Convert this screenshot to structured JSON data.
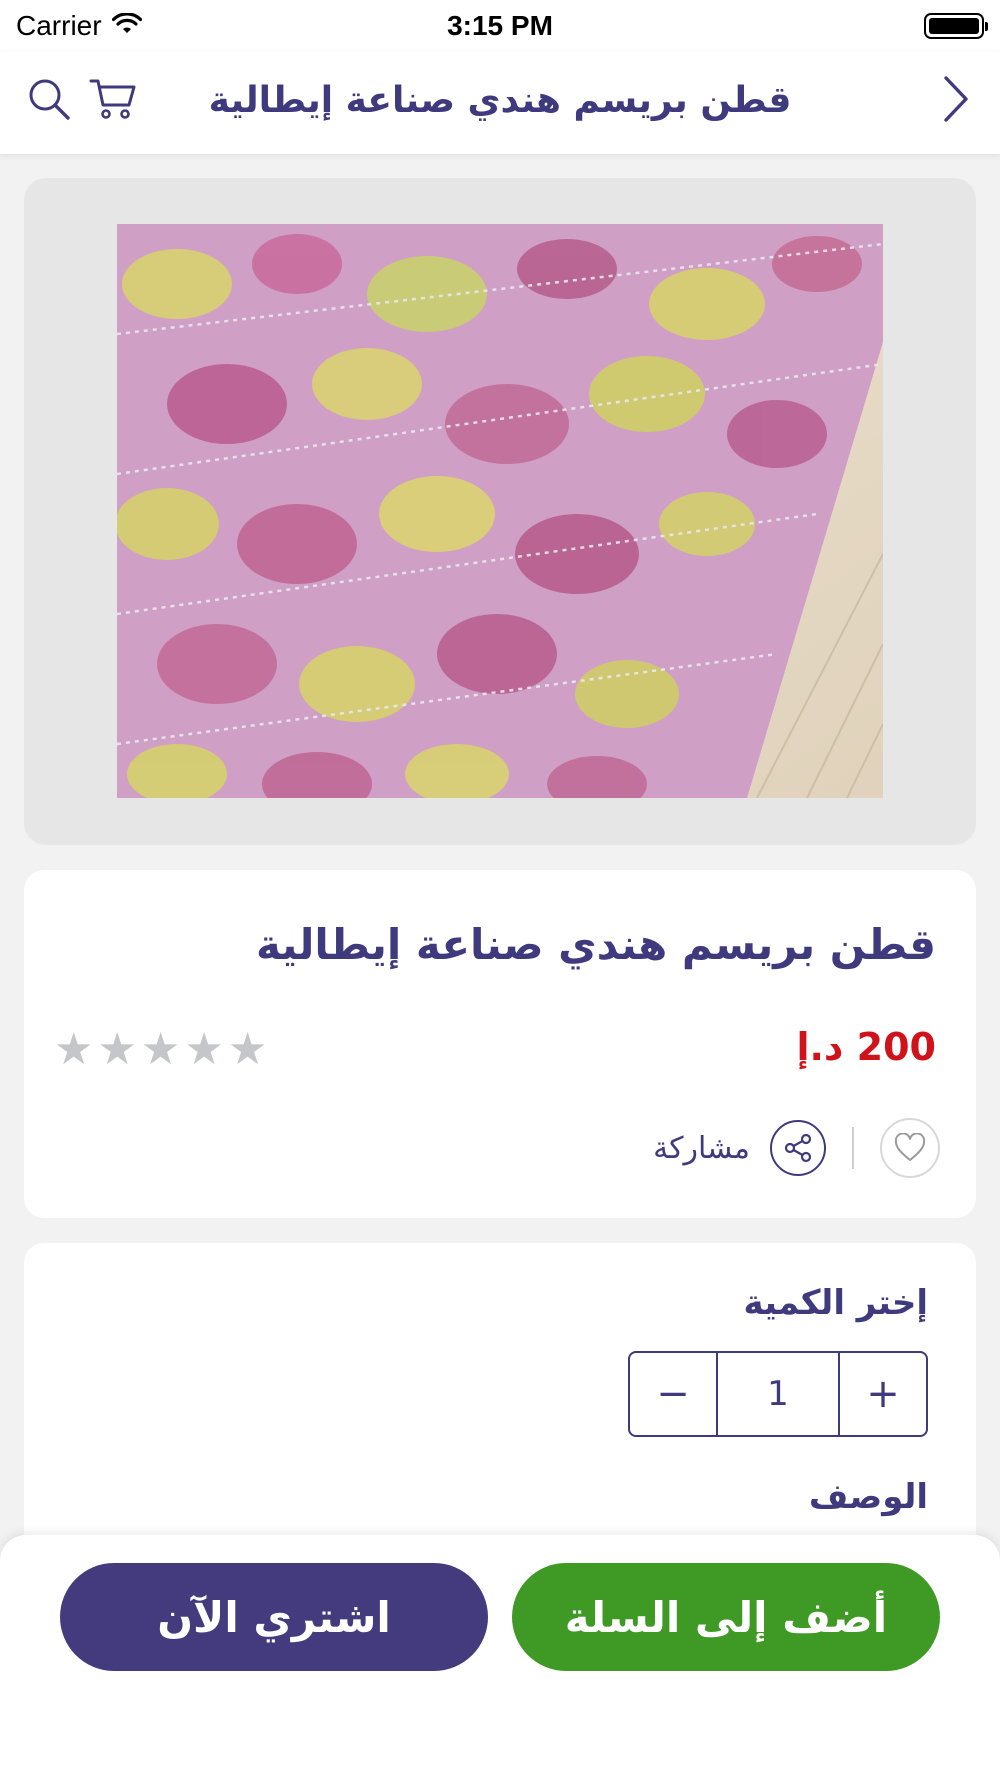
{
  "status_bar": {
    "carrier": "Carrier",
    "time": "3:15 PM"
  },
  "nav": {
    "title": "قطن بريسم هندي صناعة إيطالية",
    "icons": [
      "search-icon",
      "cart-icon",
      "chevron-right-icon"
    ]
  },
  "product": {
    "title": "قطن بريسم هندي صناعة إيطالية",
    "price": "200 د.إ",
    "rating": 0,
    "rating_max": 5,
    "share_label": "مشاركة"
  },
  "quantity": {
    "label": "إختر الكمية",
    "value": "1",
    "minus": "−",
    "plus": "+"
  },
  "description": {
    "label": "الوصف"
  },
  "actions": {
    "buy_now": "اشتري الآن",
    "add_to_cart": "أضف إلى السلة"
  },
  "colors": {
    "primary": "#3f3a7e",
    "price": "#d0121b",
    "cart_button": "#3f9a25",
    "buy_button": "#433b7e"
  }
}
